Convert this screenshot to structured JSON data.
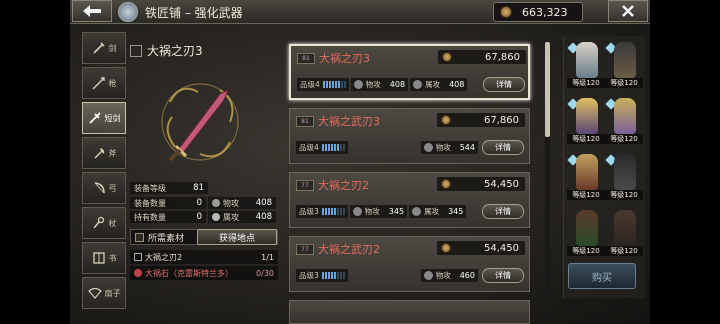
{
  "header": {
    "title": "铁匠铺 – 强化武器",
    "currency": "663,323"
  },
  "categories": [
    {
      "label": "剑",
      "icon": "sword-icon"
    },
    {
      "label": "枪",
      "icon": "spear-icon"
    },
    {
      "label": "短剑",
      "icon": "dagger-icon",
      "active": true
    },
    {
      "label": "斧",
      "icon": "axe-icon"
    },
    {
      "label": "弓",
      "icon": "bow-icon"
    },
    {
      "label": "杖",
      "icon": "staff-icon"
    },
    {
      "label": "书",
      "icon": "book-icon"
    },
    {
      "label": "扇子",
      "icon": "fan-icon"
    }
  ],
  "detail": {
    "name": "大祸之刃3",
    "equip_level_label": "装备等级",
    "equip_level": "81",
    "equip_count_label": "装备数量",
    "equip_count": "0",
    "own_count_label": "持有数量",
    "own_count": "0",
    "patk_label": "物攻",
    "patk": "408",
    "eatk_label": "属攻",
    "eatk": "408",
    "materials_label": "所需素材",
    "get_location_label": "获得地点",
    "materials": [
      {
        "name": "大祸之刃2",
        "count": "1/1"
      },
      {
        "name": "大祸石（克雷斯特兰多）",
        "count": "0/30"
      }
    ]
  },
  "list": [
    {
      "lvl": "81",
      "name": "大祸之刃3",
      "price": "67,860",
      "grade": "品级4",
      "stat1_label": "物攻",
      "stat1": "408",
      "stat2_label": "属攻",
      "stat2": "408",
      "detail": "详情",
      "selected": true
    },
    {
      "lvl": "81",
      "name": "大祸之武刃3",
      "price": "67,860",
      "grade": "品级4",
      "stat1_label": "物攻",
      "stat1": "544",
      "stat2_label": "",
      "stat2": "",
      "detail": "详情"
    },
    {
      "lvl": "77",
      "name": "大祸之刃2",
      "price": "54,450",
      "grade": "品级3",
      "stat1_label": "物攻",
      "stat1": "345",
      "stat2_label": "属攻",
      "stat2": "345",
      "detail": "详情"
    },
    {
      "lvl": "77",
      "name": "大祸之武刃2",
      "price": "54,450",
      "grade": "品级3",
      "stat1_label": "物攻",
      "stat1": "460",
      "stat2_label": "",
      "stat2": "",
      "detail": "详情"
    }
  ],
  "roster": [
    {
      "level": "等级120"
    },
    {
      "level": "等级120"
    },
    {
      "level": "等级120"
    },
    {
      "level": "等级120"
    },
    {
      "level": "等级120"
    },
    {
      "level": "等级120"
    },
    {
      "level": "等级120"
    },
    {
      "level": "等级120"
    }
  ],
  "buy_label": "购买",
  "colors": {
    "accent_name": "#e86c5a",
    "grade_pip": "#6fa4d8"
  }
}
